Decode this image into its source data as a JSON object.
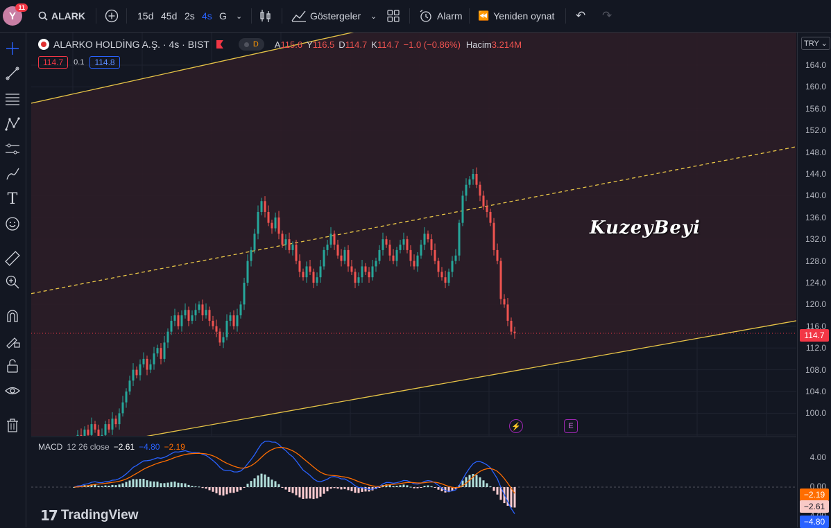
{
  "topbar": {
    "avatar_letter": "Y",
    "notifications": "11",
    "symbol": "ALARK",
    "intervals": [
      "15d",
      "45d",
      "2s",
      "4s",
      "G"
    ],
    "indicators_label": "Göstergeler",
    "alarm_label": "Alarm",
    "replay_label": "Yeniden oynat"
  },
  "legend": {
    "title": "ALARKO HOLDİNG A.Ş. · 4s · BIST",
    "d_badge": "D",
    "open_label": "A",
    "open": "115.6",
    "high_label": "Y",
    "high": "116.5",
    "low_label": "D",
    "low": "114.7",
    "close_label": "K",
    "close": "114.7",
    "change": "−1.0 (−0.86%)",
    "volume_label": "Hacim",
    "volume": "3.214M",
    "bid": "114.7",
    "spread": "0.1",
    "ask": "114.8"
  },
  "price_axis": {
    "currency": "TRY",
    "ticks": [
      "164.0",
      "160.0",
      "156.0",
      "152.0",
      "148.0",
      "144.0",
      "140.0",
      "136.0",
      "132.0",
      "128.0",
      "124.0",
      "120.0",
      "116.0",
      "112.0",
      "108.0",
      "104.0",
      "100.0"
    ],
    "last_price": "114.7"
  },
  "watermark": "KuzeyBeyi",
  "chips": {
    "flash": "⚡",
    "earnings": "E"
  },
  "macd": {
    "label": "MACD",
    "params": "12 26 close",
    "hist": "−2.61",
    "macd": "−4.80",
    "signal": "−2.19",
    "ticks": [
      "4.00",
      "0.00",
      "-4.00"
    ],
    "tag_signal": "−2.19",
    "tag_hist": "−2.61",
    "tag_macd": "−4.80"
  },
  "brand": "TradingView",
  "colors": {
    "up": "#26a69a",
    "down": "#ef5350",
    "channel": "#e8c547",
    "macd": "#2962ff",
    "signal": "#ff6d00",
    "bg": "#131722",
    "zone": "#2c1d27"
  },
  "chart_data": {
    "type": "candlestick",
    "symbol": "ALARKO HOLDİNG A.Ş.",
    "interval": "4s",
    "ylim": [
      96,
      168
    ],
    "closes": [
      94,
      96,
      95,
      97,
      96,
      98,
      97,
      95,
      96,
      98,
      97,
      99,
      98,
      100,
      102,
      104,
      106,
      108,
      107,
      109,
      110,
      108,
      109,
      111,
      112,
      110,
      113,
      115,
      117,
      118,
      116,
      118,
      119,
      117,
      118,
      119,
      120,
      118,
      119,
      117,
      116,
      115,
      113,
      114,
      117,
      118,
      116,
      118,
      120,
      124,
      128,
      130,
      133,
      137,
      139,
      137,
      135,
      134,
      136,
      133,
      131,
      132,
      130,
      131,
      128,
      126,
      125,
      127,
      126,
      124,
      125,
      127,
      130,
      131,
      133,
      131,
      129,
      128,
      130,
      127,
      126,
      124,
      125,
      127,
      126,
      125,
      127,
      128,
      130,
      132,
      131,
      129,
      128,
      130,
      131,
      132,
      130,
      128,
      127,
      129,
      131,
      133,
      132,
      130,
      128,
      126,
      125,
      124,
      126,
      128,
      129,
      135,
      140,
      142,
      143,
      144,
      142,
      140,
      138,
      137,
      135,
      130,
      128,
      121,
      120,
      117,
      115,
      114.7
    ],
    "channel_upper": {
      "start": 157,
      "end": 188
    },
    "channel_mid": {
      "start": 122,
      "end": 149
    },
    "channel_lower": {
      "start": 92,
      "end": 117
    },
    "last_price": 114.7
  }
}
